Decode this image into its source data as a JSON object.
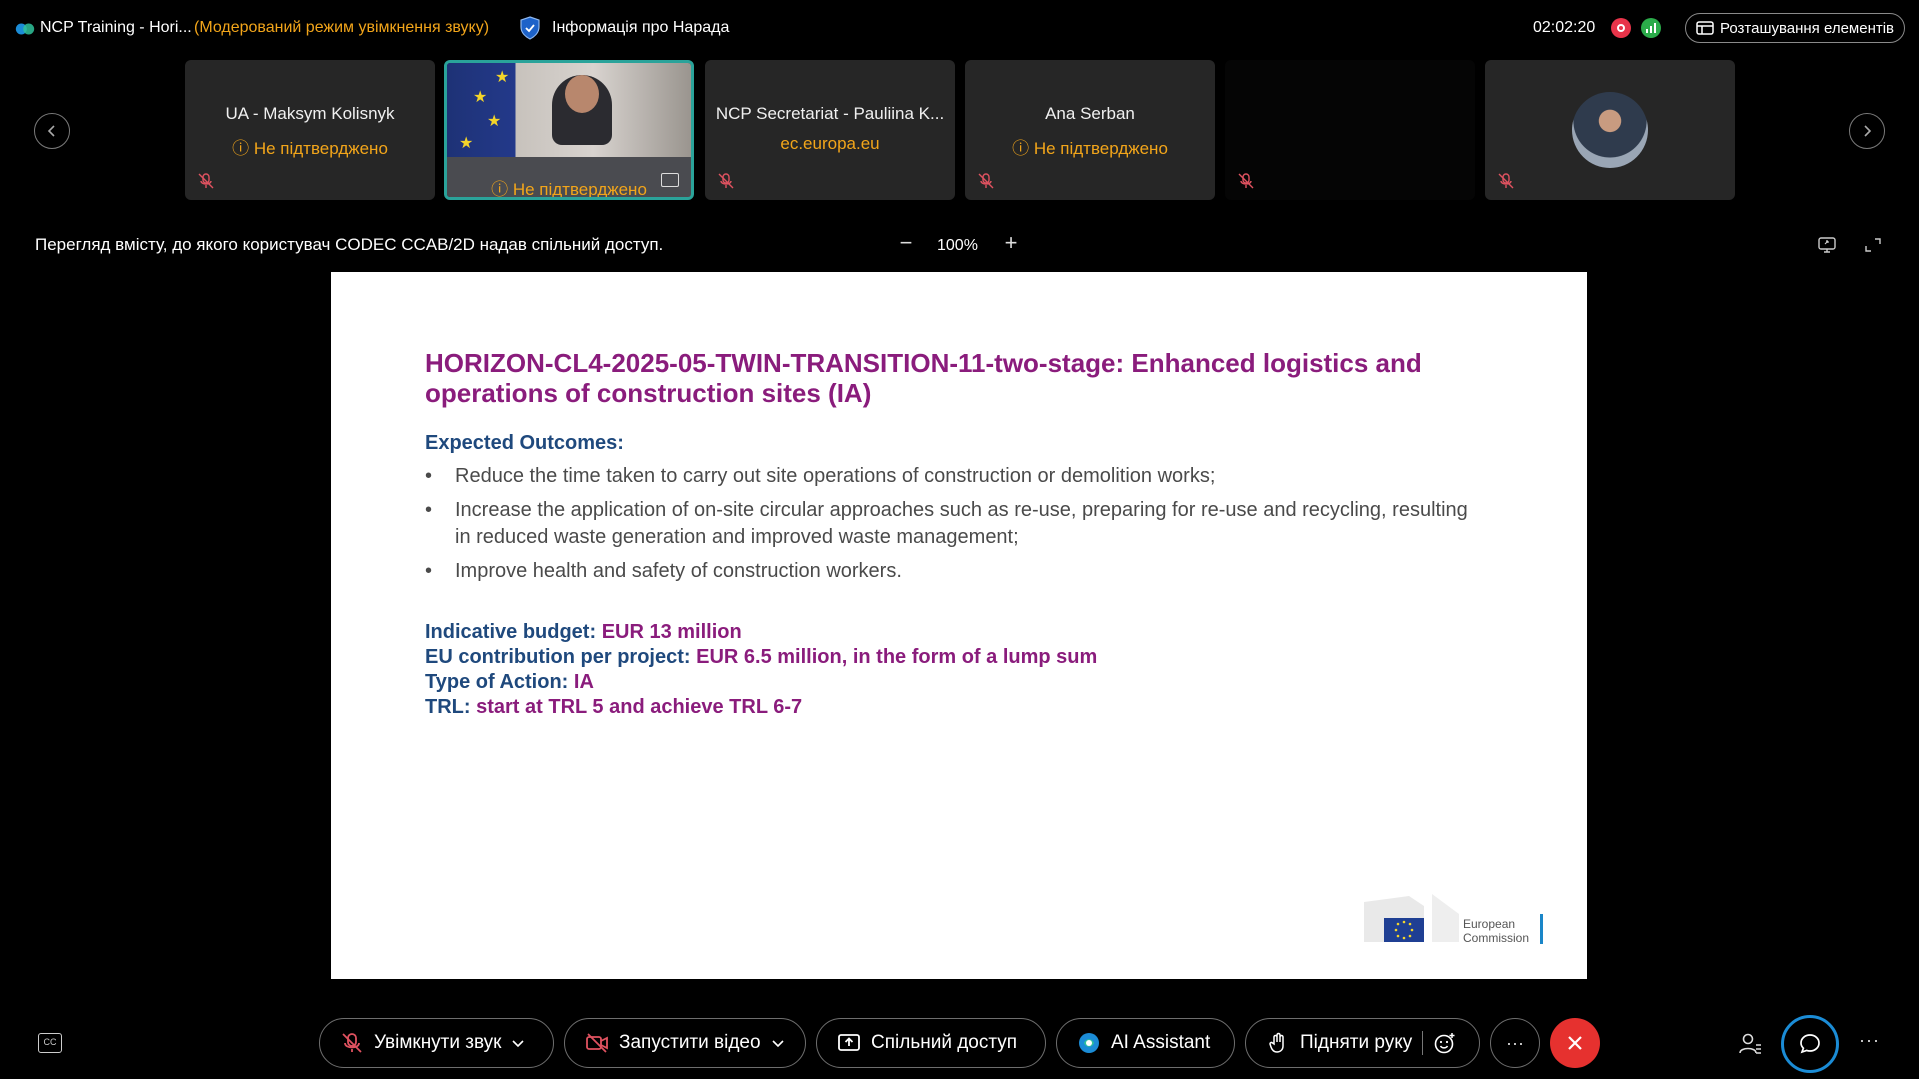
{
  "topbar": {
    "app_title": "NCP Training - Hori...",
    "moderated_mode": "(Модерований режим увімкнення звуку)",
    "meeting_info": "Інформація про Нарада",
    "timer": "02:02:20",
    "layout_button": "Розташування елементів"
  },
  "participants": [
    {
      "name": "UA - Maksym Kolisnyk",
      "status": "Не підтверджено"
    },
    {
      "name": "",
      "status": "Не підтверджено"
    },
    {
      "name": "NCP Secretariat - Pauliina K...",
      "status": "ec.europa.eu"
    },
    {
      "name": "Ana Serban",
      "status": "Не підтверджено"
    },
    {
      "name": "",
      "status": ""
    },
    {
      "name": "",
      "status": ""
    }
  ],
  "share_bar": {
    "caption": "Перегляд вмісту, до якого користувач CODEC CCAB/2D надав спільний доступ.",
    "zoom": "100%"
  },
  "slide": {
    "title": "HORIZON-CL4-2025-05-TWIN-TRANSITION-11-two-stage: Enhanced logistics and operations of construction sites (IA)",
    "outcomes_heading": "Expected Outcomes:",
    "outcomes": [
      "Reduce the time taken to carry out site operations of construction or demolition works;",
      "Increase the application of on-site circular approaches such as re-use, preparing for re-use and recycling, resulting in reduced waste generation and improved waste management;",
      "Improve health and safety of construction workers."
    ],
    "facts": [
      {
        "key": "Indicative budget:",
        "value": "EUR 13 million"
      },
      {
        "key": "EU contribution per project:",
        "value": "EUR 6.5 million, in the form of a lump sum"
      },
      {
        "key": "Type of Action:",
        "value": "IA"
      },
      {
        "key": "TRL:",
        "value": "start at TRL 5 and achieve TRL 6-7"
      }
    ],
    "logo_line1": "European",
    "logo_line2": "Commission"
  },
  "controls": {
    "cc_label": "CC",
    "unmute": "Увімкнути звук",
    "start_video": "Запустити відео",
    "share": "Спільний доступ",
    "ai_assistant": "AI Assistant",
    "raise_hand": "Підняти руку"
  },
  "colors": {
    "accent_teal": "#2aa39a",
    "warning_orange": "#f2a51a",
    "end_call_red": "#e6312f",
    "chat_blue": "#1b8cd6",
    "slide_title_purple": "#8a1c7c",
    "slide_heading_navy": "#1f497d"
  }
}
